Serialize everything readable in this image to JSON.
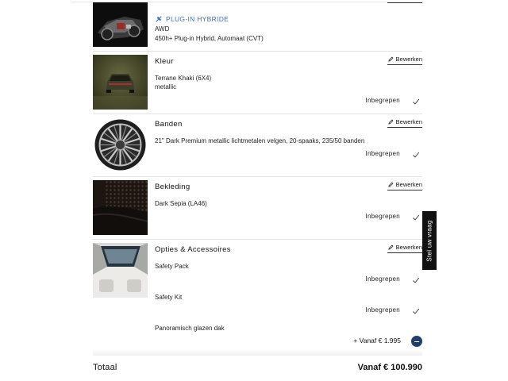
{
  "sections": {
    "drivetrain": {
      "badge": "PLUG-IN HYBRIDE",
      "line1": "AWD",
      "line2": "450h+ Plug-in Hybrid, Automaat (CVT)"
    },
    "color": {
      "title": "Kleur",
      "edit": "Bewerken",
      "line1": "Terrane Khaki (6X4)",
      "line2": "metallic",
      "status": "Inbegrepen"
    },
    "tires": {
      "title": "Banden",
      "edit": "Bewerken",
      "line1": "21\" Dark Premium metallic lichtmetalen velgen, 20-spaaks, 235/50 banden",
      "status": "Inbegrepen"
    },
    "upholstery": {
      "title": "Bekleding",
      "edit": "Bewerken",
      "line1": "Dark Sepia (LA46)",
      "status": "Inbegrepen"
    },
    "options": {
      "title": "Opties & Accessoires",
      "edit": "Bewerken",
      "items": [
        {
          "name": "Safety Pack",
          "status": "Inbegrepen"
        },
        {
          "name": "Safety Kit",
          "status": "Inbegrepen"
        },
        {
          "name": "Panoramisch glazen dak",
          "price": "+ Vanaf € 1.995"
        }
      ]
    }
  },
  "footer": {
    "total_label": "Totaal",
    "total_value": "Vanaf € 100.990"
  },
  "side_tab": "Stel uw vraag",
  "colors": {
    "accent_blue": "#3a6fbf",
    "remove_button": "#233d6b"
  }
}
